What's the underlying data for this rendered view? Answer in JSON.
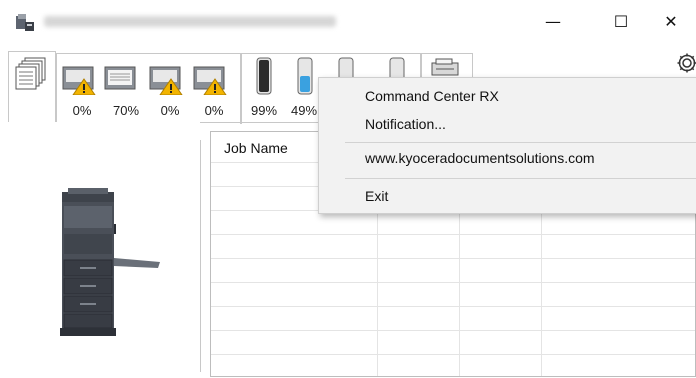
{
  "window": {
    "minimize_label": "—",
    "maximize_label": "☐",
    "close_label": "✕",
    "settings_icon": "gear-icon",
    "app_icon": "printer-app-icon"
  },
  "toolbar": {
    "paper": [
      {
        "percent": "0%",
        "warning": true,
        "level": 0
      },
      {
        "percent": "70%",
        "warning": false,
        "level": 0.7
      },
      {
        "percent": "0%",
        "warning": true,
        "level": 0
      },
      {
        "percent": "0%",
        "warning": true,
        "level": 0
      }
    ],
    "toner": [
      {
        "percent": "99%",
        "color": "#2b2b2b",
        "level": 0.99
      },
      {
        "percent": "49%",
        "color": "#3aa1e0",
        "level": 0.49
      },
      {
        "color": "#e0308c",
        "level": 0.3
      },
      {
        "color": "#f0e020",
        "level": 0.3
      }
    ]
  },
  "table": {
    "column_job_name": "Job Name"
  },
  "context_menu": {
    "items": [
      {
        "label": "Command Center RX"
      },
      {
        "label": "Notification..."
      },
      {
        "label": "www.kyoceradocumentsolutions.com"
      },
      {
        "label": "Exit"
      }
    ]
  },
  "colors": {
    "warning": "#f2b400",
    "menu_bg": "#f2f2f2"
  }
}
